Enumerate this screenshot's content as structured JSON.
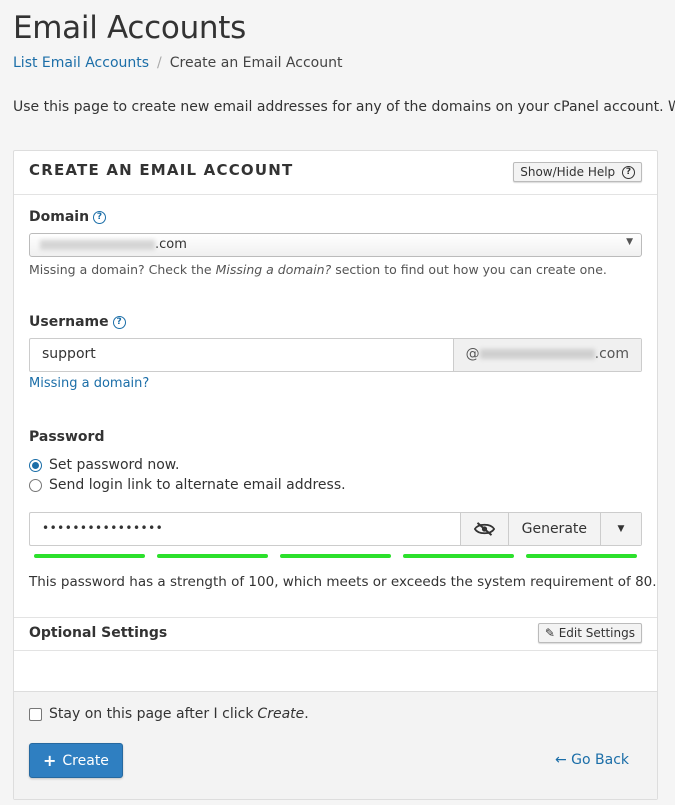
{
  "page": {
    "title": "Email Accounts",
    "breadcrumb": {
      "link": "List Email Accounts",
      "separator": "/",
      "current": "Create an Email Account"
    },
    "intro": "Use this page to create new email addresses for any of the domains on your cPanel account. Want to l"
  },
  "card": {
    "title": "CREATE AN EMAIL ACCOUNT",
    "help_button": "Show/Hide Help",
    "domain": {
      "label": "Domain",
      "selected_suffix": ".com",
      "hint_prefix": "Missing a domain? Check the ",
      "hint_em": "Missing a domain?",
      "hint_suffix": " section to find out how you can create one."
    },
    "username": {
      "label": "Username",
      "value": "support",
      "addon_at": "@",
      "addon_suffix": ".com",
      "missing_link": "Missing a domain?"
    },
    "password": {
      "label": "Password",
      "option_set_now": "Set password now.",
      "option_send_link": "Send login link to alternate email address.",
      "selected_option": "Set password now.",
      "masked_value": "••••••••••••••••",
      "generate_label": "Generate",
      "strength_message": "This password has a strength of 100, which meets or exceeds the system requirement of 80.",
      "strength_color": "#2ce02c"
    },
    "optional": {
      "title": "Optional Settings",
      "edit_button": "Edit Settings"
    },
    "footer": {
      "stay_prefix": "Stay on this page after I click ",
      "stay_em": "Create",
      "stay_suffix": ".",
      "stay_checked": false,
      "create_label": "Create",
      "go_back_label": "Go Back"
    }
  },
  "colors": {
    "accent": "#1b6ea8",
    "primary_button": "#2f7fc1"
  }
}
